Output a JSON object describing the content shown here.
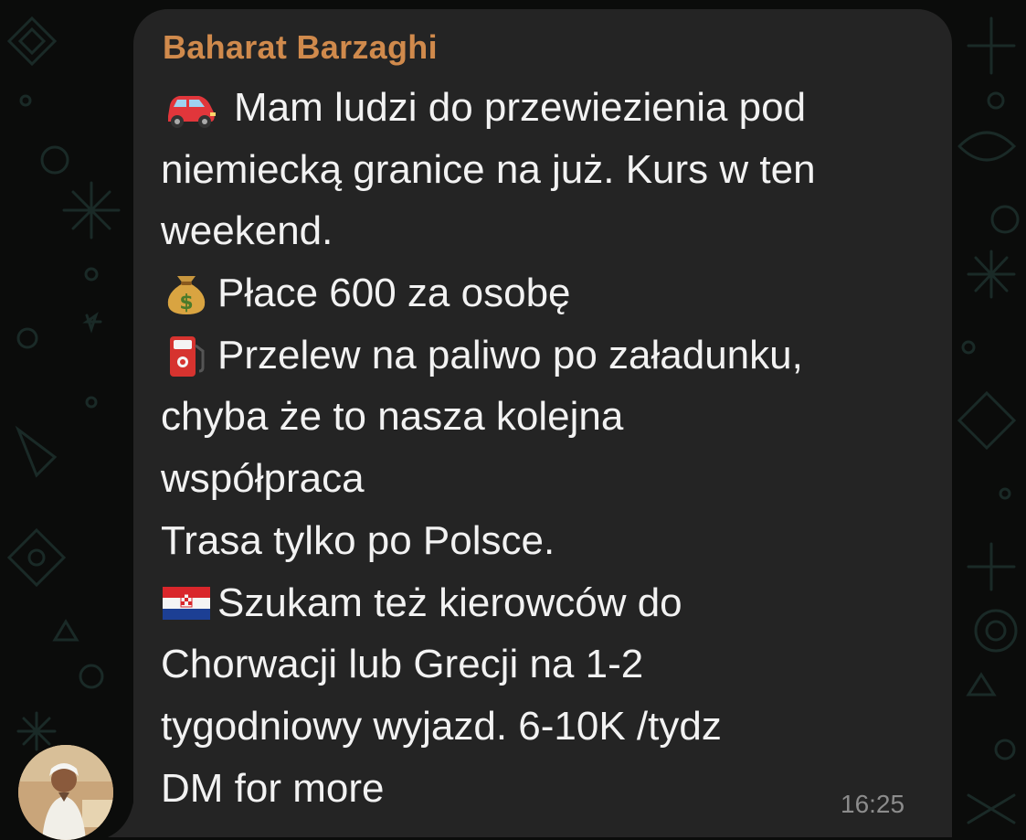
{
  "chat": {
    "background_color": "#0b0c0b",
    "doodle_color": "#1a2a27",
    "bubble_color": "#242424"
  },
  "message": {
    "sender_name": "Baharat Barzaghi",
    "sender_color": "#d08a4c",
    "lines": [
      {
        "icon": "red-car-emoji",
        "text": "Mam ludzi do przewiezienia pod"
      },
      {
        "icon": null,
        "text": "niemiecką granice na już. Kurs w ten"
      },
      {
        "icon": null,
        "text": "weekend."
      },
      {
        "icon": "money-bag-emoji",
        "text": "Płace 600 za osobę"
      },
      {
        "icon": "fuel-pump-emoji",
        "text": "Przelew na paliwo po załadunku,"
      },
      {
        "icon": null,
        "text": "chyba że to nasza kolejna"
      },
      {
        "icon": null,
        "text": "współpraca"
      },
      {
        "icon": null,
        "text": "Trasa tylko po Polsce."
      },
      {
        "icon": "croatia-flag-emoji",
        "text": "Szukam też kierowców do"
      },
      {
        "icon": null,
        "text": "Chorwacji lub Grecji na 1-2"
      },
      {
        "icon": null,
        "text": "tygodniowy wyjazd. 6-10K /tydz"
      },
      {
        "icon": null,
        "text": "DM for more"
      }
    ],
    "time": "16:25"
  },
  "avatar": {
    "icon": "sender-avatar"
  }
}
